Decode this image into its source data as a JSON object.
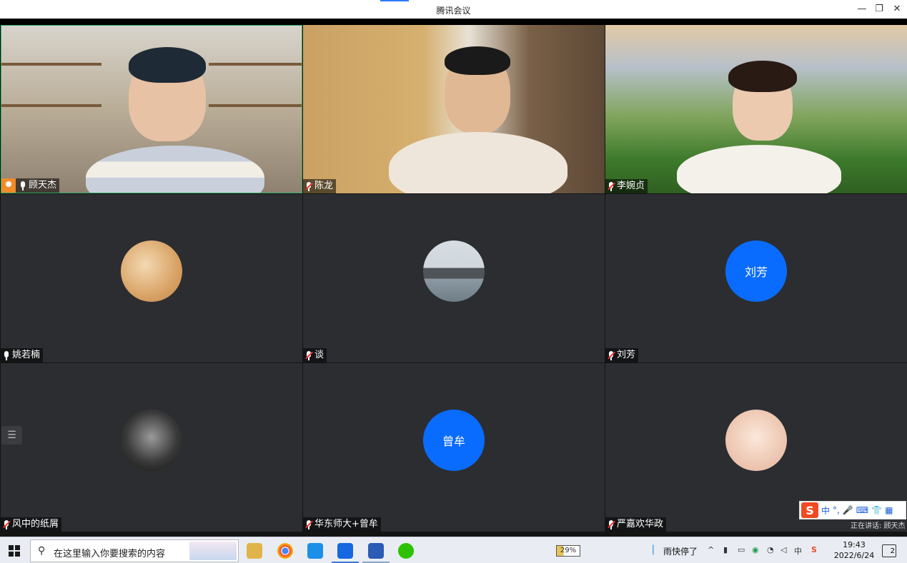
{
  "window": {
    "title": "腾讯会议",
    "controls": {
      "minimize": "—",
      "restore": "❐",
      "close": "✕"
    }
  },
  "tiles": [
    {
      "name": "顾天杰",
      "mic": "on",
      "host": true,
      "type": "video"
    },
    {
      "name": "陈龙",
      "mic": "off",
      "type": "video"
    },
    {
      "name": "李婉贞",
      "mic": "off",
      "type": "video"
    },
    {
      "name": "姚若楠",
      "mic": "on",
      "type": "avatar-image"
    },
    {
      "name": "谈",
      "mic": "off",
      "type": "avatar-image"
    },
    {
      "name": "刘芳",
      "mic": "off",
      "type": "avatar-text",
      "avatar_text": "刘芳",
      "avatar_color": "#0a6cff"
    },
    {
      "name": "风中的纸屑",
      "mic": "off",
      "type": "avatar-image"
    },
    {
      "name": "华东师大+曾牟",
      "mic": "off",
      "type": "avatar-text",
      "avatar_text": "曾牟",
      "avatar_color": "#0a6cff"
    },
    {
      "name": "严嘉欢华政",
      "mic": "off",
      "type": "avatar-image"
    }
  ],
  "ime": {
    "logo": "S",
    "mode": "中",
    "punct": "°,"
  },
  "speaking_label": "正在讲话: 顾天杰",
  "taskbar": {
    "search_placeholder": "在这里输入你要搜索的内容",
    "battery": "29%",
    "weather": "雨快停了",
    "ime_indicator": "中",
    "time": "19:43",
    "date": "2022/6/24",
    "notifications": "2"
  }
}
